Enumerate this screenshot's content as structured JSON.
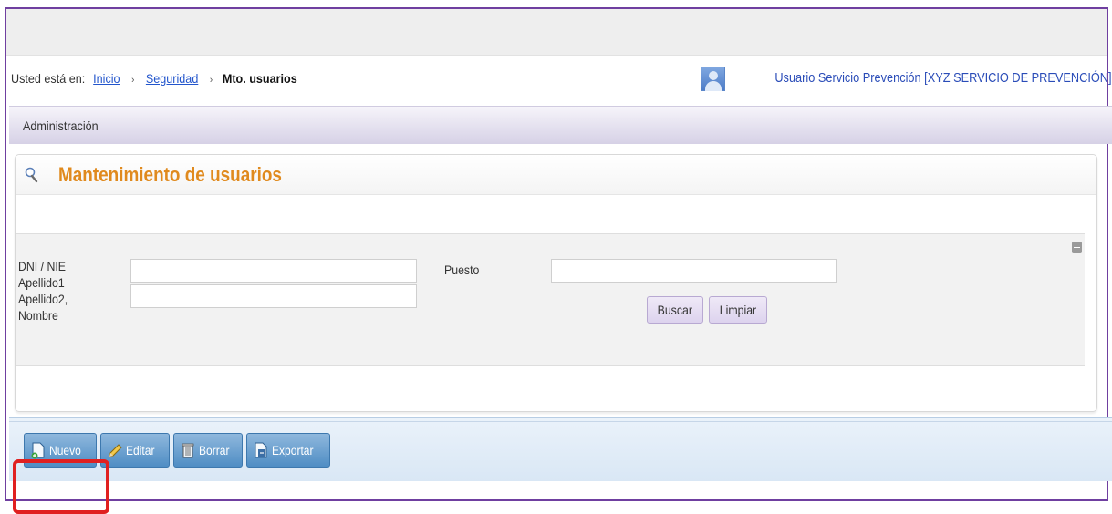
{
  "breadcrumb": {
    "prefix": "Usted está en:",
    "items": [
      "Inicio",
      "Seguridad"
    ],
    "separator": "›",
    "current": "Mto. usuarios"
  },
  "user": {
    "label": "Usuario Servicio Prevención [XYZ SERVICIO DE PREVENCIÓN]"
  },
  "nav": {
    "admin_label": "Administración"
  },
  "panel": {
    "title": "Mantenimiento de usuarios"
  },
  "filter": {
    "dni_label": "DNI / NIE",
    "dni_value": "",
    "apellido1_label": "Apellido1",
    "apellido1_value": "",
    "apellido2_label": "Apellido2,",
    "nombre_label": "Nombre",
    "puesto_label": "Puesto",
    "puesto_value": "",
    "buscar": "Buscar",
    "limpiar": "Limpiar"
  },
  "toolbar": {
    "nuevo": "Nuevo",
    "editar": "Editar",
    "borrar": "Borrar",
    "exportar": "Exportar"
  },
  "colors": {
    "frame": "#6f3fa0",
    "title": "#e08a1e",
    "link": "#2255cc",
    "highlight": "#e02020",
    "toolbar_button": "#4f8dc4"
  }
}
